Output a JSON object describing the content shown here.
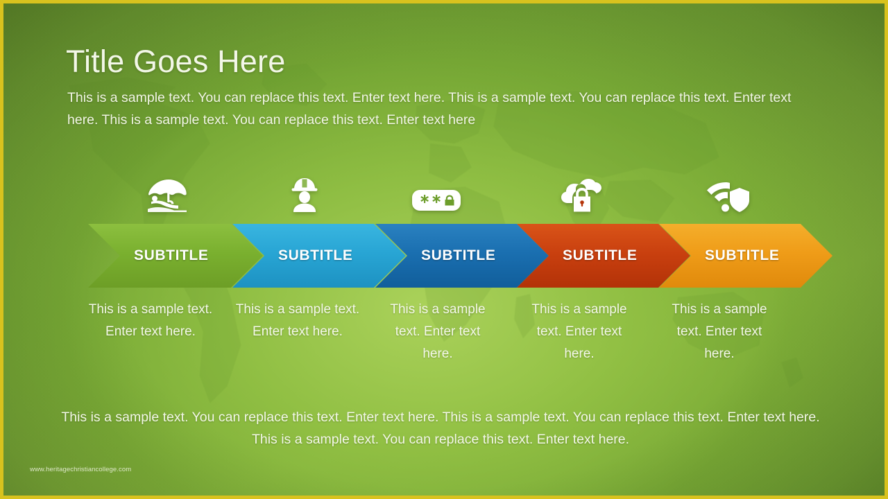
{
  "slide": {
    "border_color": "#d8c21e",
    "background_color": "#79a836",
    "title": "Title Goes Here",
    "subtitle": "This is a sample text. You can replace this text. Enter text here. This is a sample text. You can replace this text. Enter text here. This is a sample text. You can replace this text. Enter text here",
    "footer_text": "This is a sample text. You can replace this text. Enter text here. This is a sample text. You can replace this text. Enter text here. This is a sample text. You can replace this text. Enter text here.",
    "watermark": "www.heritagechristiancollege.com"
  },
  "process": {
    "steps": [
      {
        "label": "SUBTITLE",
        "body": "This is a sample text. Enter text here.",
        "icon": "beach-umbrella-icon",
        "color": "#7cb033",
        "color_dark": "#6a9c27"
      },
      {
        "label": "SUBTITLE",
        "body": "This is a sample text. Enter text here.",
        "icon": "construction-worker-icon",
        "color": "#2ba6d8",
        "color_dark": "#1d8fc4"
      },
      {
        "label": "SUBTITLE",
        "body": "This is a sample text. Enter text here.",
        "icon": "password-field-icon",
        "color": "#1a6fb0",
        "color_dark": "#135c99"
      },
      {
        "label": "SUBTITLE",
        "body": "This is a sample text. Enter text here.",
        "icon": "cloud-lock-icon",
        "color": "#cf4412",
        "color_dark": "#b5350a"
      },
      {
        "label": "SUBTITLE",
        "body": "This is a sample text. Enter text here.",
        "icon": "wifi-shield-icon",
        "color": "#efa01f",
        "color_dark": "#dd8c10"
      }
    ]
  }
}
